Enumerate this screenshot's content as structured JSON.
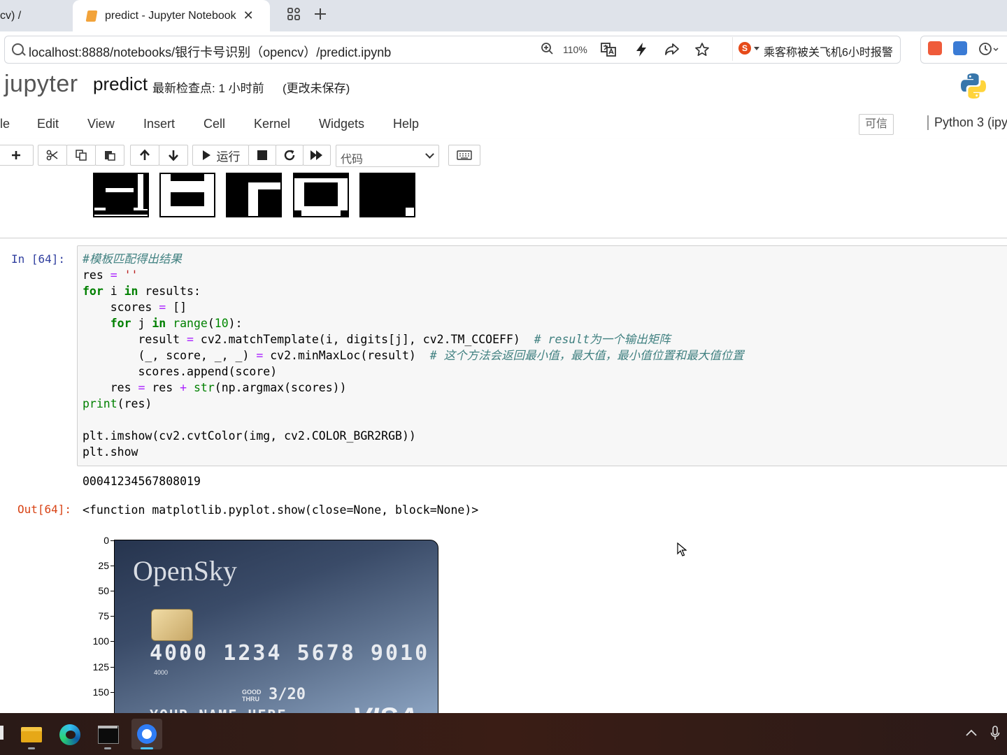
{
  "browser": {
    "prev_tab_title": "cv)  /",
    "active_tab_title": "predict - Jupyter Notebook",
    "close_glyph": "✕",
    "url": "localhost:8888/notebooks/银行卡号识别（opencv）/predict.ipynb",
    "zoom": "110%",
    "news_text": "乘客称被关飞机6小时报警",
    "icons": [
      "search-icon",
      "zoom-icon",
      "translate-icon",
      "lightning-icon",
      "share-icon",
      "star-icon",
      "sogou-icon",
      "pdf-icon",
      "translate-ext-icon",
      "history-icon"
    ]
  },
  "jupyter": {
    "logo_text": "jupyter",
    "notebook_name": "predict",
    "checkpoint": "最新检查点: 1 小时前",
    "unsaved": "(更改未保存)",
    "menu": [
      "le",
      "Edit",
      "View",
      "Insert",
      "Cell",
      "Kernel",
      "Widgets",
      "Help"
    ],
    "trusted": "可信",
    "kernel_name": "Python 3 (ipy",
    "toolbar": {
      "run_label": "运行",
      "cell_type": "代码"
    }
  },
  "cell": {
    "in_prompt": "In  [64]:",
    "stdout": "00041234567808019",
    "out_prompt": "Out[64]:",
    "out_repr": "<function matplotlib.pyplot.show(close=None, block=None)>"
  },
  "plot": {
    "yticks": [
      "0",
      "25",
      "50",
      "75",
      "100",
      "125",
      "150"
    ],
    "card": {
      "brand": "OpenSky",
      "number": "4000 1234 5678 9010",
      "small_number": "4000",
      "good_thru": "GOOD THRU",
      "expiry": "3/20",
      "holder": "YOUR NAME HERE",
      "network": "VISA"
    }
  },
  "colors": {
    "tab_strip": "#dfe3ea",
    "jupyter_prompt_in": "#303f9f",
    "jupyter_prompt_out": "#d84315",
    "code_keyword": "#008000",
    "code_comment": "#408080"
  }
}
